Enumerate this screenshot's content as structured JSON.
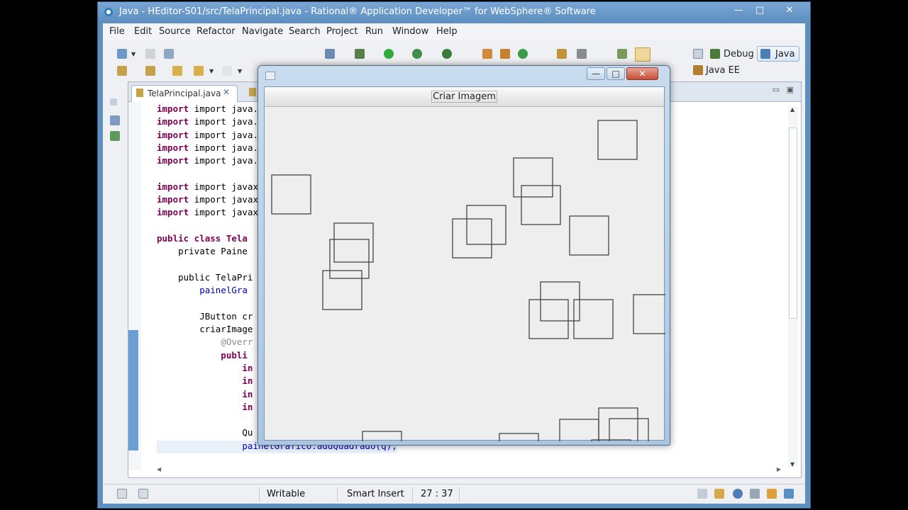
{
  "window": {
    "title": "Java - HEditor-S01/src/TelaPrincipal.java - Rational® Application Developer™ for WebSphere® Software",
    "minimize": "—",
    "maximize": "□",
    "close": "✕"
  },
  "menu": [
    "File",
    "Edit",
    "Source",
    "Refactor",
    "Navigate",
    "Search",
    "Project",
    "Run",
    "Window",
    "Help"
  ],
  "perspectives": {
    "debug": "Debug",
    "java": "Java",
    "java_ee": "Java EE"
  },
  "editor": {
    "tab_label": "TelaPrincipal.java",
    "code_lines": [
      "import java.awt.Bo",
      "import java.awt.Co",
      "import java.awt.Gr",
      "import java.awt.ev",
      "import java.awt.ev",
      "",
      "import javax.swing",
      "import javax.swing",
      "import javax.swing",
      "",
      "public class Tela",
      "    private Paine",
      "",
      "    public TelaPri",
      "        painelGra",
      "",
      "        JButton cr",
      "        criarImage",
      "            @Overr",
      "            publi",
      "                in",
      "                in",
      "                in",
      "                in",
      "",
      "                Qu",
      "                painelGrafico.addQuadrado(q);"
    ]
  },
  "status": {
    "writable": "Writable",
    "insert_mode": "Smart Insert",
    "position": "27 : 37"
  },
  "dialog": {
    "button_label": "Criar Imagem",
    "rect_count": 20
  },
  "colors": {
    "title_blue": "#5d8fc0",
    "keyword": "#7f0055",
    "field": "#0000c0",
    "close_red": "#c74d37"
  }
}
